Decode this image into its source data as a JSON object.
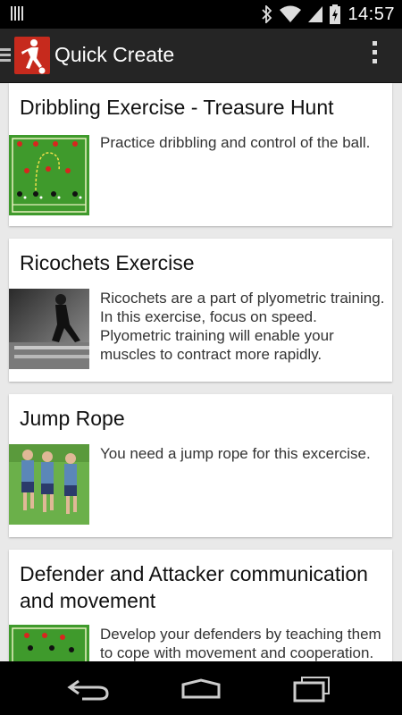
{
  "status_bar": {
    "time": "14:57"
  },
  "app_bar": {
    "title": "Quick Create"
  },
  "exercises": [
    {
      "title": "Dribbling Exercise - Treasure Hunt",
      "description": "Practice dribbling and control of the ball."
    },
    {
      "title": "Ricochets Exercise",
      "description": "Ricochets are a part of plyometric training. In this exercise, focus on speed. Plyometric training will enable your muscles to contract more rapidly."
    },
    {
      "title": "Jump Rope",
      "description": "You need a jump rope for this excercise."
    },
    {
      "title": "Defender and Attacker communication and movement",
      "description": "Develop your defenders by teaching them to cope with movement and cooperation."
    }
  ],
  "colors": {
    "accent": "#c62a1d",
    "actionbar": "#252525",
    "field": "#3f9a2c"
  },
  "icons": {
    "bluetooth": "bluetooth-icon",
    "wifi": "wifi-icon",
    "battery": "battery-icon",
    "back": "back-icon",
    "home": "home-icon",
    "recents": "recent-apps-icon",
    "menu": "overflow-menu-icon"
  }
}
